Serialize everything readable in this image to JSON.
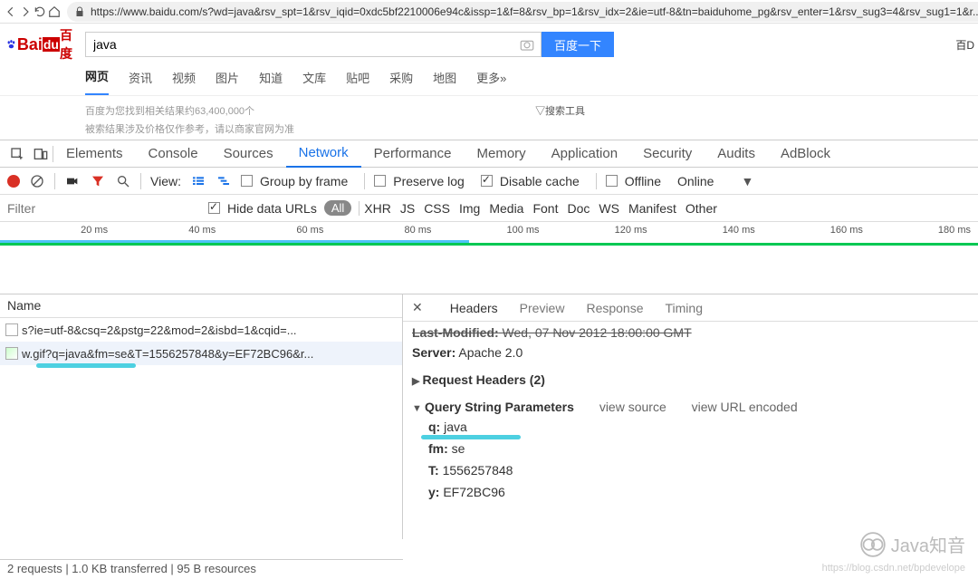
{
  "browser": {
    "url": "https://www.baidu.com/s?wd=java&rsv_spt=1&rsv_iqid=0xdc5bf2210006e94c&issp=1&f=8&rsv_bp=1&rsv_idx=2&ie=utf-8&tn=baiduhome_pg&rsv_enter=1&rsv_sug3=4&rsv_sug1=1&r..."
  },
  "baidu": {
    "logo_bai": "Bai",
    "logo_cn": "百度",
    "search_value": "java",
    "search_btn": "百度一下",
    "right_text": "百D",
    "tabs": [
      "网页",
      "资讯",
      "视频",
      "图片",
      "知道",
      "文库",
      "贴吧",
      "采购",
      "地图",
      "更多»"
    ],
    "results_count": "百度为您找到相关结果约63,400,000个",
    "search_tools": "▽搜索工具",
    "results_hint": "被索结果涉及价格仅作参考，请以商家官网为准"
  },
  "devtools": {
    "tabs": [
      "Elements",
      "Console",
      "Sources",
      "Network",
      "Performance",
      "Memory",
      "Application",
      "Security",
      "Audits",
      "AdBlock"
    ],
    "toolbar": {
      "view_label": "View:",
      "group_by_frame": "Group by frame",
      "preserve_log": "Preserve log",
      "disable_cache": "Disable cache",
      "offline": "Offline",
      "online": "Online"
    },
    "filterbar": {
      "filter_placeholder": "Filter",
      "hide_data_urls": "Hide data URLs",
      "all": "All",
      "types": [
        "XHR",
        "JS",
        "CSS",
        "Img",
        "Media",
        "Font",
        "Doc",
        "WS",
        "Manifest",
        "Other"
      ]
    },
    "timeline_labels": [
      "20 ms",
      "40 ms",
      "60 ms",
      "80 ms",
      "100 ms",
      "120 ms",
      "140 ms",
      "160 ms",
      "180 ms"
    ],
    "left": {
      "name_header": "Name",
      "requests": [
        "s?ie=utf-8&csq=2&pstg=22&mod=2&isbd=1&cqid=...",
        "w.gif?q=java&fm=se&T=1556257848&y=EF72BC96&r..."
      ]
    },
    "right": {
      "tabs": [
        "Headers",
        "Preview",
        "Response",
        "Timing"
      ],
      "last_modified_label": "Last-Modified:",
      "last_modified_value": "Wed, 07 Nov 2012 18:00:00 GMT",
      "server_label": "Server:",
      "server_value": "Apache 2.0",
      "req_headers": "Request Headers (2)",
      "qsp": "Query String Parameters",
      "view_source": "view source",
      "view_url_encoded": "view URL encoded",
      "params": [
        {
          "k": "q:",
          "v": "java"
        },
        {
          "k": "fm:",
          "v": "se"
        },
        {
          "k": "T:",
          "v": "1556257848"
        },
        {
          "k": "y:",
          "v": "EF72BC96"
        }
      ]
    },
    "status": "2 requests  |  1.0 KB transferred  |  95 B resources"
  },
  "watermark": {
    "text": "Java知音",
    "subtext": "https://blog.csdn.net/bpdevelope"
  }
}
